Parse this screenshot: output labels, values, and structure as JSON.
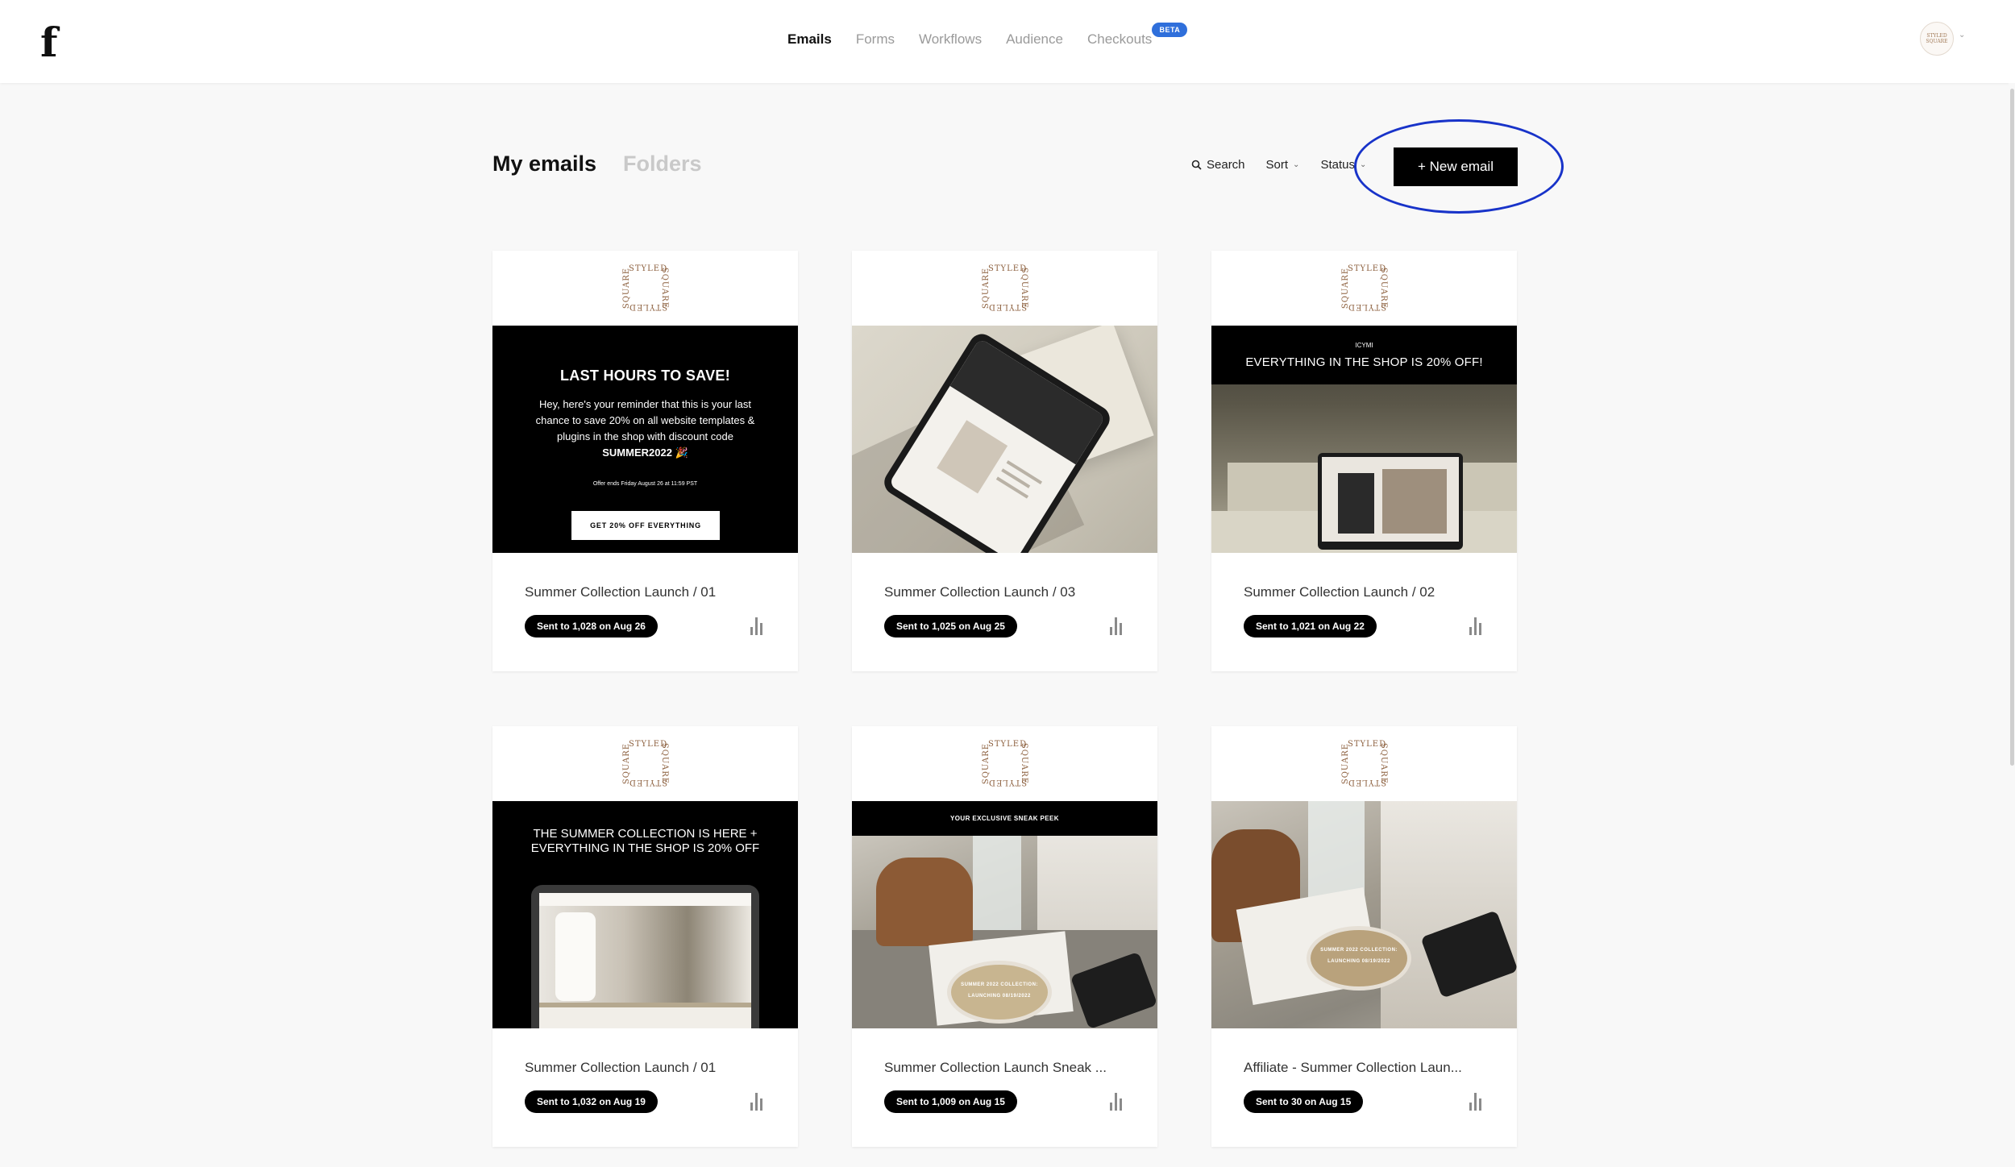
{
  "nav": {
    "logo": "f",
    "items": [
      {
        "label": "Emails",
        "active": true
      },
      {
        "label": "Forms",
        "active": false
      },
      {
        "label": "Workflows",
        "active": false
      },
      {
        "label": "Audience",
        "active": false
      },
      {
        "label": "Checkouts",
        "active": false
      }
    ],
    "beta_badge": "BETA",
    "avatar_text": "STYLED SQUARE"
  },
  "header": {
    "tabs": [
      "My emails",
      "Folders"
    ],
    "search_label": "Search",
    "sort_label": "Sort",
    "status_label": "Status",
    "new_email_label": "+ New email"
  },
  "brand_mark": {
    "top": "STYLED",
    "side": "SQUARE"
  },
  "cards": [
    {
      "title": "Summer Collection Launch / 01",
      "badge": "Sent to 1,028 on Aug 26",
      "preview": {
        "headline": "LAST HOURS TO SAVE!",
        "body": "Hey, here's your reminder that this is your last chance to save 20% on all website templates & plugins in the shop with discount code",
        "code": "SUMMER2022 🎉",
        "small": "Offer ends Friday August 26 at 11:59 PST",
        "button": "GET 20% OFF EVERYTHING"
      }
    },
    {
      "title": "Summer Collection Launch / 03",
      "badge": "Sent to 1,025 on Aug 25"
    },
    {
      "title": "Summer Collection Launch / 02",
      "badge": "Sent to 1,021 on Aug 22",
      "preview": {
        "kicker": "ICYMI",
        "headline": "EVERYTHING IN THE SHOP IS 20% OFF!"
      }
    },
    {
      "title": "Summer Collection Launch / 01",
      "badge": "Sent to 1,032 on Aug 19",
      "preview": {
        "headline": "THE SUMMER COLLECTION IS HERE + EVERYTHING IN THE SHOP IS 20% OFF"
      }
    },
    {
      "title": "Summer Collection Launch Sneak ...",
      "badge": "Sent to 1,009 on Aug 15",
      "preview": {
        "band": "YOUR EXCLUSIVE SNEAK PEEK",
        "cup_text": "SUMMER 2022 COLLECTION: LAUNCHING 08/19/2022"
      }
    },
    {
      "title": "Affiliate - Summer Collection Laun...",
      "badge": "Sent to 30 on Aug 15",
      "preview": {
        "cup_text": "SUMMER 2022 COLLECTION: LAUNCHING 08/19/2022"
      }
    }
  ],
  "colors": {
    "accent_blue": "#2f6fdb",
    "highlight_ring": "#1833c9",
    "brand_brown": "#8b5e3c"
  }
}
